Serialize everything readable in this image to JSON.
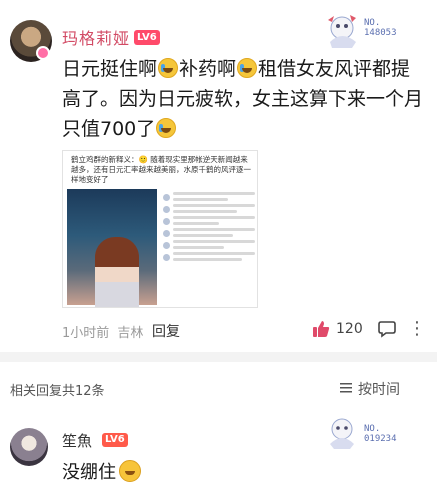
{
  "post": {
    "username": "玛格莉娅",
    "level": "LV6",
    "medal_no": [
      "NO.",
      "148053"
    ],
    "content": {
      "seg1": "日元挺住啊",
      "seg2": "补药啊",
      "seg3": "租借女友风评都提高了。因为日元疲软，女主这算下来一个月只值700了"
    },
    "image": {
      "caption": "鹤立鸡群的新释义：🙂 随着现实里那帐逆天新闻越来越多，还有日元汇率越来越美丽，水原千鹤的风评逐一样地变好了"
    },
    "time": "1小时前",
    "location": "吉林",
    "reply_label": "回复",
    "like_count": "120"
  },
  "replies_section": {
    "header": "相关回复共12条",
    "sort_label": "按时间"
  },
  "reply": {
    "username": "笙魚",
    "level": "LV6",
    "medal_no": [
      "NO.",
      "019234"
    ],
    "content": "没绷住"
  },
  "colors": {
    "username": "#d24a64",
    "badge": "#ff4a6a",
    "like": "#e04a6a"
  }
}
